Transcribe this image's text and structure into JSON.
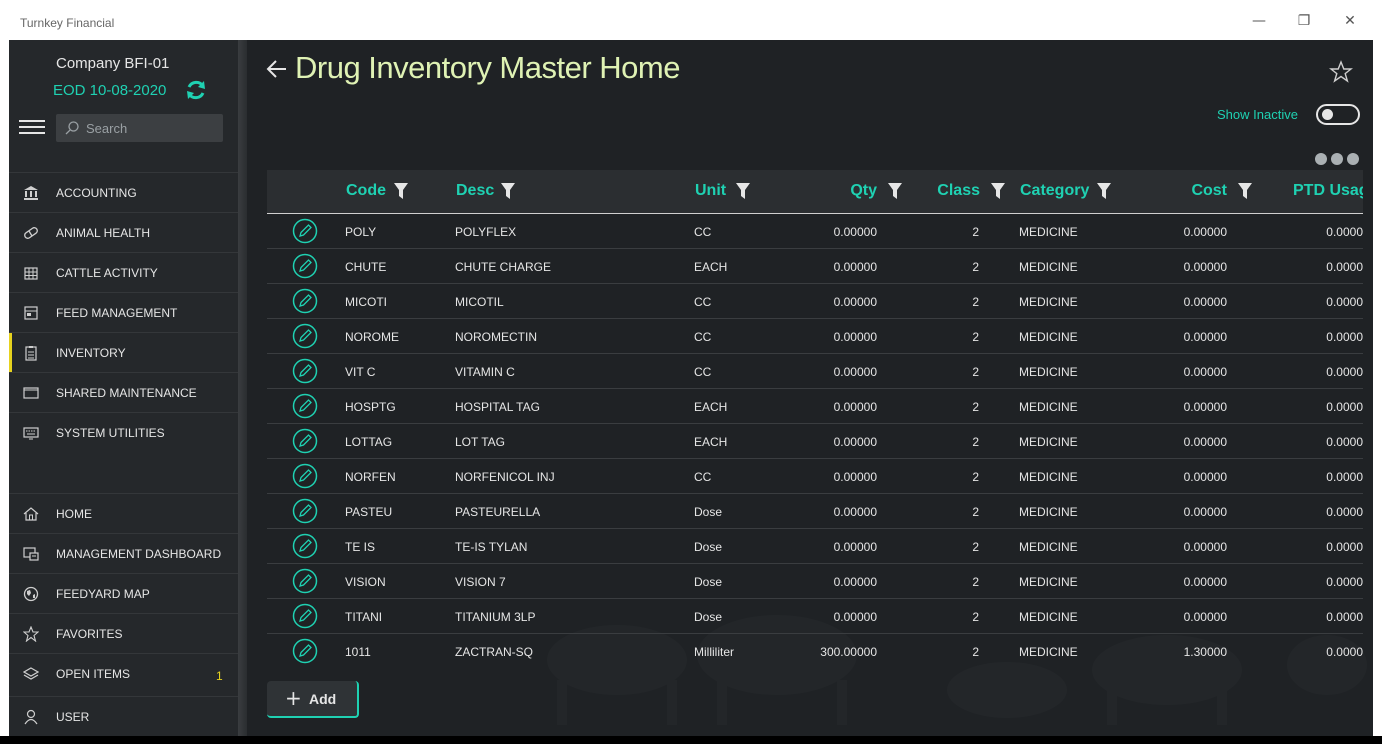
{
  "window": {
    "title": "Turnkey Financial",
    "minimize": "—",
    "restore": "❐",
    "close": "✕"
  },
  "sidebar": {
    "company": "Company BFI-01",
    "eod": "EOD  10-08-2020",
    "search_placeholder": "Search",
    "items": [
      {
        "label": "ACCOUNTING",
        "icon": "bank-icon"
      },
      {
        "label": "ANIMAL HEALTH",
        "icon": "pill-icon"
      },
      {
        "label": "CATTLE ACTIVITY",
        "icon": "grid-building-icon"
      },
      {
        "label": "FEED MANAGEMENT",
        "icon": "feed-icon"
      },
      {
        "label": "INVENTORY",
        "icon": "clipboard-icon",
        "active": true
      },
      {
        "label": "SHARED MAINTENANCE",
        "icon": "folder-icon"
      },
      {
        "label": "SYSTEM UTILITIES",
        "icon": "keyboard-icon"
      }
    ],
    "bottom_items": [
      {
        "label": "HOME",
        "icon": "home-icon"
      },
      {
        "label": "MANAGEMENT DASHBOARD",
        "icon": "dashboard-icon"
      },
      {
        "label": "FEEDYARD MAP",
        "icon": "globe-icon"
      },
      {
        "label": "FAVORITES",
        "icon": "star-icon"
      },
      {
        "label": "OPEN ITEMS",
        "icon": "layers-icon",
        "badge": "1"
      },
      {
        "label": "USER",
        "icon": "user-icon"
      }
    ]
  },
  "header": {
    "title": "Drug Inventory Master Home",
    "show_inactive_label": "Show Inactive",
    "show_inactive": false
  },
  "table": {
    "columns": [
      "Code",
      "Desc",
      "Unit",
      "Qty",
      "Class",
      "Category",
      "Cost",
      "PTD Usag"
    ],
    "rows": [
      [
        "POLY",
        "POLYFLEX",
        "CC",
        "0.00000",
        "2",
        "MEDICINE",
        "0.00000",
        "0.0000"
      ],
      [
        "CHUTE",
        "CHUTE CHARGE",
        "EACH",
        "0.00000",
        "2",
        "MEDICINE",
        "0.00000",
        "0.0000"
      ],
      [
        "MICOTI",
        "MICOTIL",
        "CC",
        "0.00000",
        "2",
        "MEDICINE",
        "0.00000",
        "0.0000"
      ],
      [
        "NOROME",
        "NOROMECTIN",
        "CC",
        "0.00000",
        "2",
        "MEDICINE",
        "0.00000",
        "0.0000"
      ],
      [
        "VIT C",
        "VITAMIN C",
        "CC",
        "0.00000",
        "2",
        "MEDICINE",
        "0.00000",
        "0.0000"
      ],
      [
        "HOSPTG",
        "HOSPITAL TAG",
        "EACH",
        "0.00000",
        "2",
        "MEDICINE",
        "0.00000",
        "0.0000"
      ],
      [
        "LOTTAG",
        "LOT TAG",
        "EACH",
        "0.00000",
        "2",
        "MEDICINE",
        "0.00000",
        "0.0000"
      ],
      [
        "NORFEN",
        "NORFENICOL INJ",
        "CC",
        "0.00000",
        "2",
        "MEDICINE",
        "0.00000",
        "0.0000"
      ],
      [
        "PASTEU",
        "PASTEURELLA",
        "Dose",
        "0.00000",
        "2",
        "MEDICINE",
        "0.00000",
        "0.0000"
      ],
      [
        "TE IS",
        "TE-IS TYLAN",
        "Dose",
        "0.00000",
        "2",
        "MEDICINE",
        "0.00000",
        "0.0000"
      ],
      [
        "VISION",
        "VISION 7",
        "Dose",
        "0.00000",
        "2",
        "MEDICINE",
        "0.00000",
        "0.0000"
      ],
      [
        "TITANI",
        "TITANIUM 3LP",
        "Dose",
        "0.00000",
        "2",
        "MEDICINE",
        "0.00000",
        "0.0000"
      ],
      [
        "1011",
        "ZACTRAN-SQ",
        "Milliliter",
        "300.00000",
        "2",
        "MEDICINE",
        "1.30000",
        "0.0000"
      ]
    ]
  },
  "add_button": {
    "label": "Add"
  },
  "colors": {
    "accent": "#1fd1b2",
    "title": "#dff2b4",
    "active_marker": "#e6d21e",
    "background": "#1f2225",
    "sidebar": "#25282b"
  }
}
